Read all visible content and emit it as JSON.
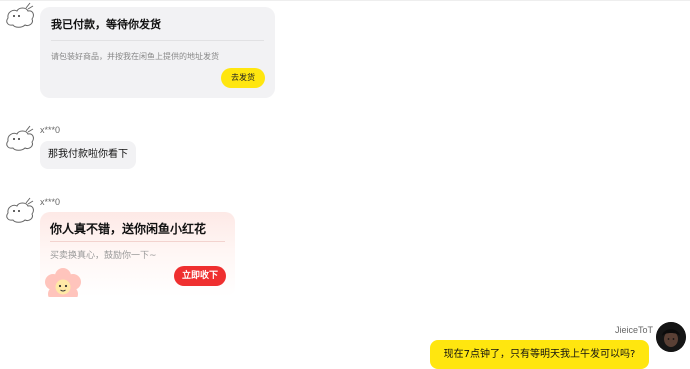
{
  "order_card": {
    "title": "我已付款，等待你发货",
    "desc": "请包装好商品，并按我在闲鱼上提供的地址发货",
    "button": "去发货"
  },
  "messages": [
    {
      "nickname": "x***0",
      "text": "那我付款啦你看下"
    }
  ],
  "flower_card": {
    "nickname": "x***0",
    "title": "你人真不错，送你闲鱼小红花",
    "desc": "买卖换真心，鼓励你一下~",
    "button": "立即收下"
  },
  "my_message": {
    "nickname": "JieiceToT",
    "text": "现在7点钟了，只有等明天我上午发可以吗?"
  },
  "colors": {
    "accent_yellow": "#ffe60f",
    "accent_red": "#ef2f2f",
    "bubble_gray": "#f2f2f4"
  }
}
